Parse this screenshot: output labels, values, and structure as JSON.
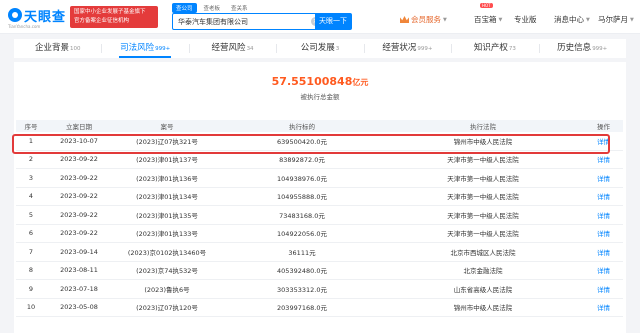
{
  "brand": {
    "name": "天眼查",
    "domain": "TianYancha.com",
    "slogan_line1": "国家中小企业发展子基金旗下",
    "slogan_line2": "官方备案企业征信机构"
  },
  "search": {
    "tabs": [
      "查公司",
      "查老板",
      "查关系"
    ],
    "value": "华泰汽车集团有限公司",
    "clear": "×",
    "button": "天眼一下"
  },
  "nav": {
    "vip": "会员服务",
    "baibao": "百宝箱",
    "hot": "HOT",
    "pro": "专业版",
    "messages": "消息中心",
    "user": "马尔萨月"
  },
  "tabs": [
    {
      "label": "企业背景",
      "count": "100"
    },
    {
      "label": "司法风险",
      "count": "999+"
    },
    {
      "label": "经营风险",
      "count": "34"
    },
    {
      "label": "公司发展",
      "count": "3"
    },
    {
      "label": "经营状况",
      "count": "999+"
    },
    {
      "label": "知识产权",
      "count": "73"
    },
    {
      "label": "历史信息",
      "count": "999+"
    }
  ],
  "summary": {
    "amount": "57.55100848",
    "unit": "亿元",
    "label": "被执行总金额"
  },
  "table": {
    "headers": [
      "序号",
      "立案日期",
      "案号",
      "执行标的",
      "执行法院",
      "操作"
    ],
    "rows": [
      {
        "idx": "1",
        "date": "2023-10-07",
        "case": "(2023)辽07执321号",
        "amount": "639500420.0元",
        "court": "锦州市中级人民法院",
        "op": "详情"
      },
      {
        "idx": "2",
        "date": "2023-09-22",
        "case": "(2023)津01执137号",
        "amount": "83892872.0元",
        "court": "天津市第一中级人民法院",
        "op": "详情"
      },
      {
        "idx": "3",
        "date": "2023-09-22",
        "case": "(2023)津01执136号",
        "amount": "104938976.0元",
        "court": "天津市第一中级人民法院",
        "op": "详情"
      },
      {
        "idx": "4",
        "date": "2023-09-22",
        "case": "(2023)津01执134号",
        "amount": "104955888.0元",
        "court": "天津市第一中级人民法院",
        "op": "详情"
      },
      {
        "idx": "5",
        "date": "2023-09-22",
        "case": "(2023)津01执135号",
        "amount": "73483168.0元",
        "court": "天津市第一中级人民法院",
        "op": "详情"
      },
      {
        "idx": "6",
        "date": "2023-09-22",
        "case": "(2023)津01执133号",
        "amount": "104922056.0元",
        "court": "天津市第一中级人民法院",
        "op": "详情"
      },
      {
        "idx": "7",
        "date": "2023-09-14",
        "case": "(2023)京0102执13460号",
        "amount": "36111元",
        "court": "北京市西城区人民法院",
        "op": "详情"
      },
      {
        "idx": "8",
        "date": "2023-08-11",
        "case": "(2023)京74执532号",
        "amount": "405392480.0元",
        "court": "北京金融法院",
        "op": "详情"
      },
      {
        "idx": "9",
        "date": "2023-07-18",
        "case": "(2023)鲁执6号",
        "amount": "303353312.0元",
        "court": "山东省高级人民法院",
        "op": "详情"
      },
      {
        "idx": "10",
        "date": "2023-05-08",
        "case": "(2023)辽07执120号",
        "amount": "203997168.0元",
        "court": "锦州市中级人民法院",
        "op": "详情"
      }
    ]
  },
  "colors": {
    "brand": "#0084ff",
    "amount": "#ff5a1f",
    "highlight": "#e23a3a"
  }
}
